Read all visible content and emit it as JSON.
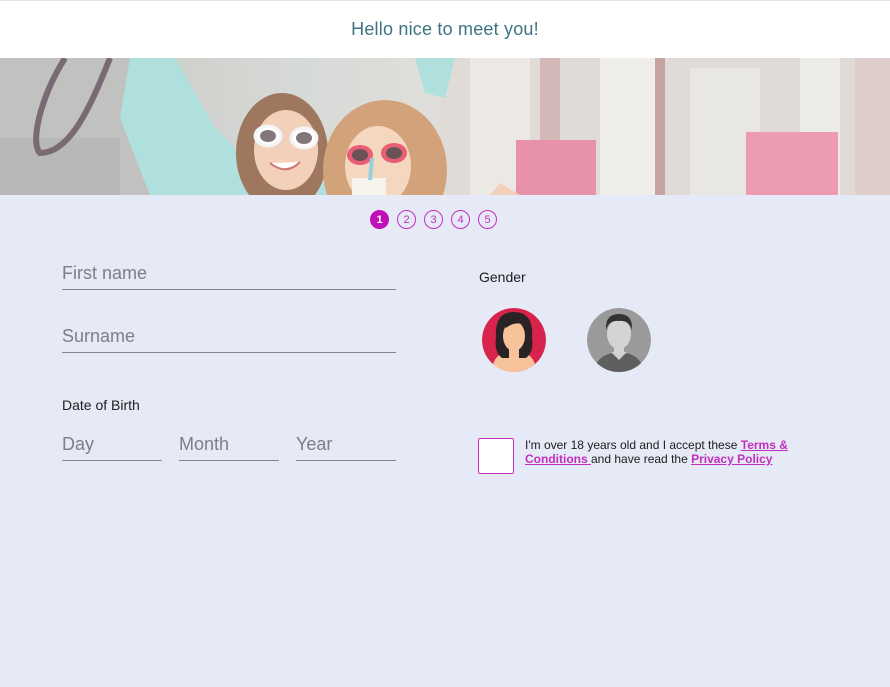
{
  "header": {
    "title": "Hello nice to meet you!"
  },
  "steps": [
    "1",
    "2",
    "3",
    "4",
    "5"
  ],
  "active_step": 1,
  "form": {
    "first_name_placeholder": "First name",
    "surname_placeholder": "Surname",
    "dob_label": "Date of Birth",
    "day_placeholder": "Day",
    "month_placeholder": "Month",
    "year_placeholder": "Year",
    "gender_label": "Gender",
    "gender_options": [
      "female-avatar-icon",
      "male-avatar-icon"
    ]
  },
  "consent": {
    "text_before": "I'm over 18 years old and I accept these ",
    "terms_link": "Terms & Conditions ",
    "text_middle": "and have read the ",
    "privacy_link": "Privacy Policy"
  },
  "colors": {
    "accent": "#c22fbd",
    "header_text": "#3f7384",
    "page_background": "#e6e9f6"
  }
}
